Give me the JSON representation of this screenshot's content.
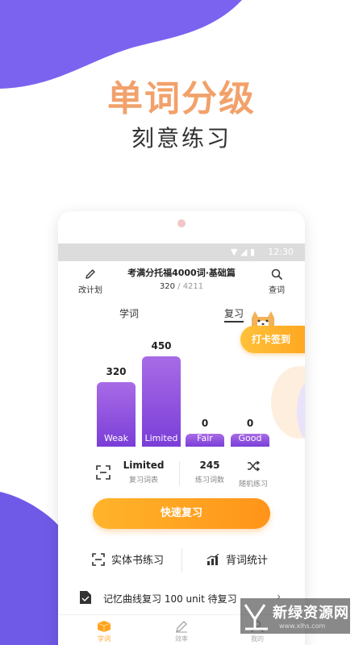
{
  "hero": {
    "title": "单词分级",
    "subtitle": "刻意练习"
  },
  "statusbar": {
    "time": "12:30"
  },
  "header": {
    "left_label": "改计划",
    "book_title": "考满分托福4000词·基础篇",
    "progress_current": "320",
    "progress_total": "/ 4211",
    "right_label": "查词"
  },
  "tabs": {
    "learn": "学词",
    "review": "复习"
  },
  "checkin_label": "打卡签到",
  "chart_data": {
    "type": "bar",
    "categories": [
      "Weak",
      "Limited",
      "Fair",
      "Good"
    ],
    "values": [
      320,
      450,
      0,
      0
    ],
    "value_labels": [
      "320",
      "450",
      "0",
      "0"
    ]
  },
  "stats": {
    "mode_value": "Limited",
    "mode_label": "复习词表",
    "count_value": "245",
    "count_label": "练习词数",
    "random_label": "随机练习"
  },
  "quick_review_label": "快速复习",
  "tools": {
    "book_practice": "实体书练习",
    "word_stats": "背词统计"
  },
  "memory_row": {
    "text": "记忆曲线复习  100 unit  待复习"
  },
  "bottom_nav": {
    "learn": "学词",
    "efficiency": "效率",
    "mine": "我的"
  },
  "watermark": {
    "title": "新绿资源网",
    "url": "www.xlhs.com"
  },
  "colors": {
    "accent_orange": "#ffa41e",
    "bar_purple": "#8a4bdc",
    "hero_peach": "#f2a16b",
    "blob_purple": "#7b63f0"
  },
  "icons": [
    "pencil-icon",
    "search-icon",
    "scan-icon",
    "shuffle-icon",
    "book-scan-icon",
    "bar-chart-icon",
    "document-icon",
    "chevron-right-icon",
    "box-icon",
    "edit-icon",
    "user-icon"
  ]
}
